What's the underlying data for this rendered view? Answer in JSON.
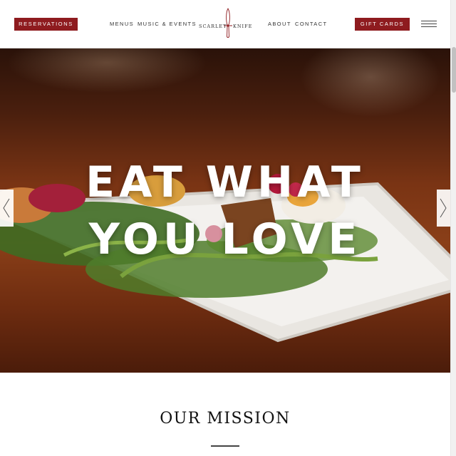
{
  "header": {
    "reservations_label": "RESERVATIONS",
    "nav_left": [
      "MENUS",
      "MUSIC & EVENTS"
    ],
    "logo": {
      "word1": "SCARLET",
      "word2": "KNIFE"
    },
    "nav_right": [
      "ABOUT",
      "CONTACT"
    ],
    "gift_cards_label": "GIFT CARDS",
    "menu_icon": "hamburger-icon"
  },
  "hero": {
    "line1": "EAT WHAT",
    "line2": "YOU LOVE",
    "prev_icon": "chevron-left-icon",
    "next_icon": "chevron-right-icon"
  },
  "mission": {
    "title": "OUR MISSION"
  },
  "colors": {
    "brand_red": "#8e1b1f",
    "text_dark": "#333333"
  }
}
